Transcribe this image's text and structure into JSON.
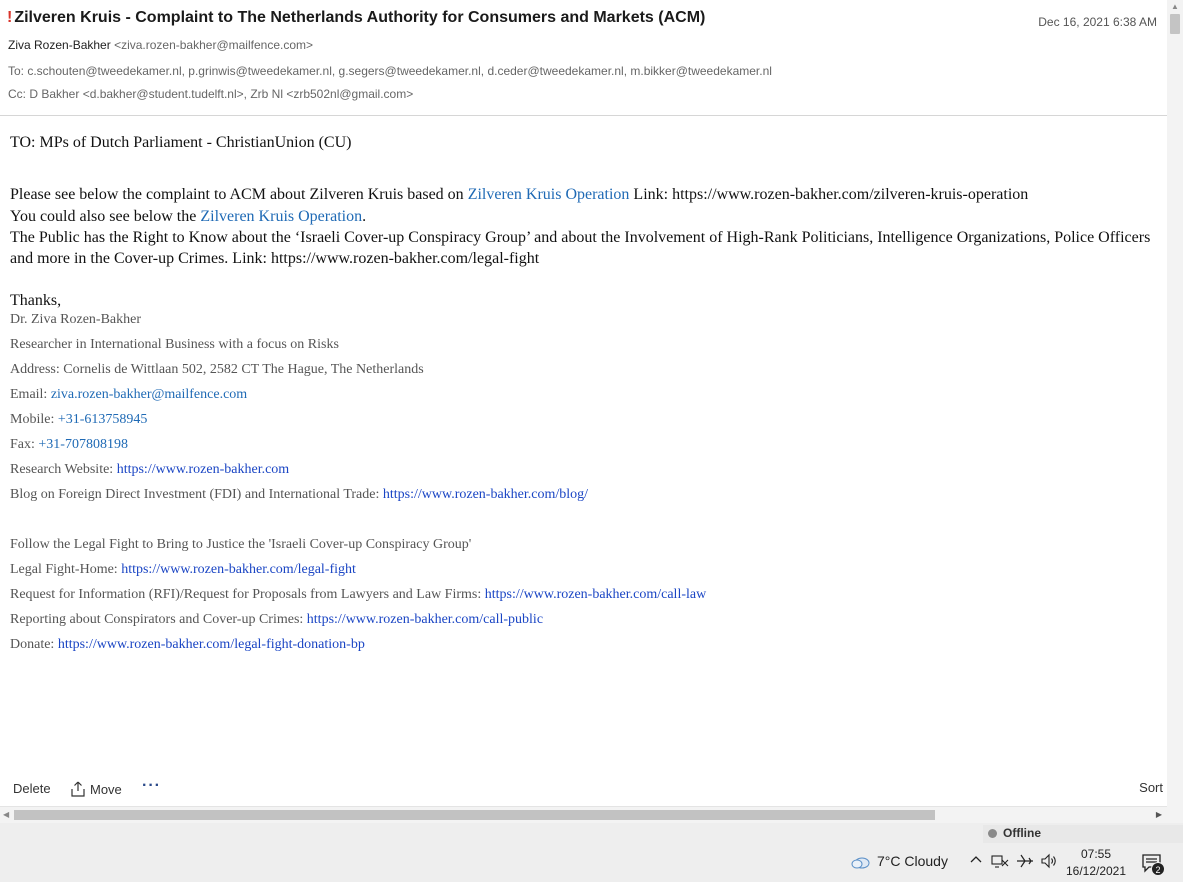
{
  "email": {
    "importance_mark": "!",
    "subject": "Zilveren Kruis - Complaint to The Netherlands Authority for Consumers and Markets (ACM)",
    "date": "Dec 16, 2021 6:38 AM",
    "from_name": "Ziva Rozen-Bakher",
    "from_address": "<ziva.rozen-bakher@mailfence.com>",
    "to_line": "To: c.schouten@tweedekamer.nl, p.grinwis@tweedekamer.nl, g.segers@tweedekamer.nl, d.ceder@tweedekamer.nl, m.bikker@tweedekamer.nl",
    "cc_line": "Cc: D Bakher <d.bakher@student.tudelft.nl>, Zrb Nl <zrb502nl@gmail.com>"
  },
  "body": {
    "greeting": "TO: MPs of Dutch Parliament - ChristianUnion (CU)",
    "p1_pre": "Please see below the complaint to ACM about Zilveren Kruis based on ",
    "p1_link": "Zilveren Kruis Operation",
    "p1_post": " Link: https://www.rozen-bakher.com/zilveren-kruis-operation",
    "p2_pre": "You could also see below the ",
    "p2_link": "Zilveren Kruis Operation",
    "p2_post": ".",
    "p3": "The Public has the Right to Know about the ‘Israeli Cover-up Conspiracy Group’ and about the Involvement of High-Rank Politicians, Intelligence Organizations, Police Officers and more in the Cover-up Crimes. Link: https://www.rozen-bakher.com/legal-fight",
    "thanks": "Thanks,"
  },
  "signature": {
    "name": "Dr. Ziva Rozen-Bakher",
    "title": "Researcher in International Business with a focus on Risks",
    "address": "Address: Cornelis de Wittlaan 502, 2582 CT The Hague, The Netherlands",
    "email_label": "Email: ",
    "email_value": "ziva.rozen-bakher@mailfence.com",
    "mobile_label": "Mobile: ",
    "mobile_value": "+31-613758945",
    "fax_label": "Fax: ",
    "fax_value": "+31-707808198",
    "website_label": "Research Website: ",
    "website_value": "https://www.rozen-bakher.com",
    "blog_label": "Blog on Foreign Direct Investment (FDI) and International Trade: ",
    "blog_value": "https://www.rozen-bakher.com/blog/",
    "follow": "Follow the Legal Fight to Bring to Justice the 'Israeli Cover-up Conspiracy Group'",
    "legal_label": "Legal Fight-Home: ",
    "legal_value": "https://www.rozen-bakher.com/legal-fight",
    "rfi_label": "Request for Information (RFI)/Request for Proposals from Lawyers and Law Firms: ",
    "rfi_value": "https://www.rozen-bakher.com/call-law",
    "report_label": "Reporting about Conspirators and Cover-up Crimes: ",
    "report_value": "https://www.rozen-bakher.com/call-public",
    "donate_label": "Donate: ",
    "donate_value": "https://www.rozen-bakher.com/legal-fight-donation-bp"
  },
  "toolbar": {
    "delete_label": "Delete",
    "move_label": "Move",
    "more_label": "···",
    "sort_label": "Sort"
  },
  "status": {
    "offline_label": "Offline"
  },
  "taskbar": {
    "weather": "7°C  Cloudy",
    "time": "07:55",
    "date": "16/12/2021",
    "notification_count": "2"
  },
  "colors": {
    "link": "#1f6ab5",
    "signature_link": "#1a45c4",
    "importance": "#d9342b"
  },
  "icons": [
    "cloud-weather-icon",
    "chevron-up-icon",
    "network-icon",
    "airplane-icon",
    "volume-icon",
    "notification-icon",
    "share-move-icon"
  ]
}
